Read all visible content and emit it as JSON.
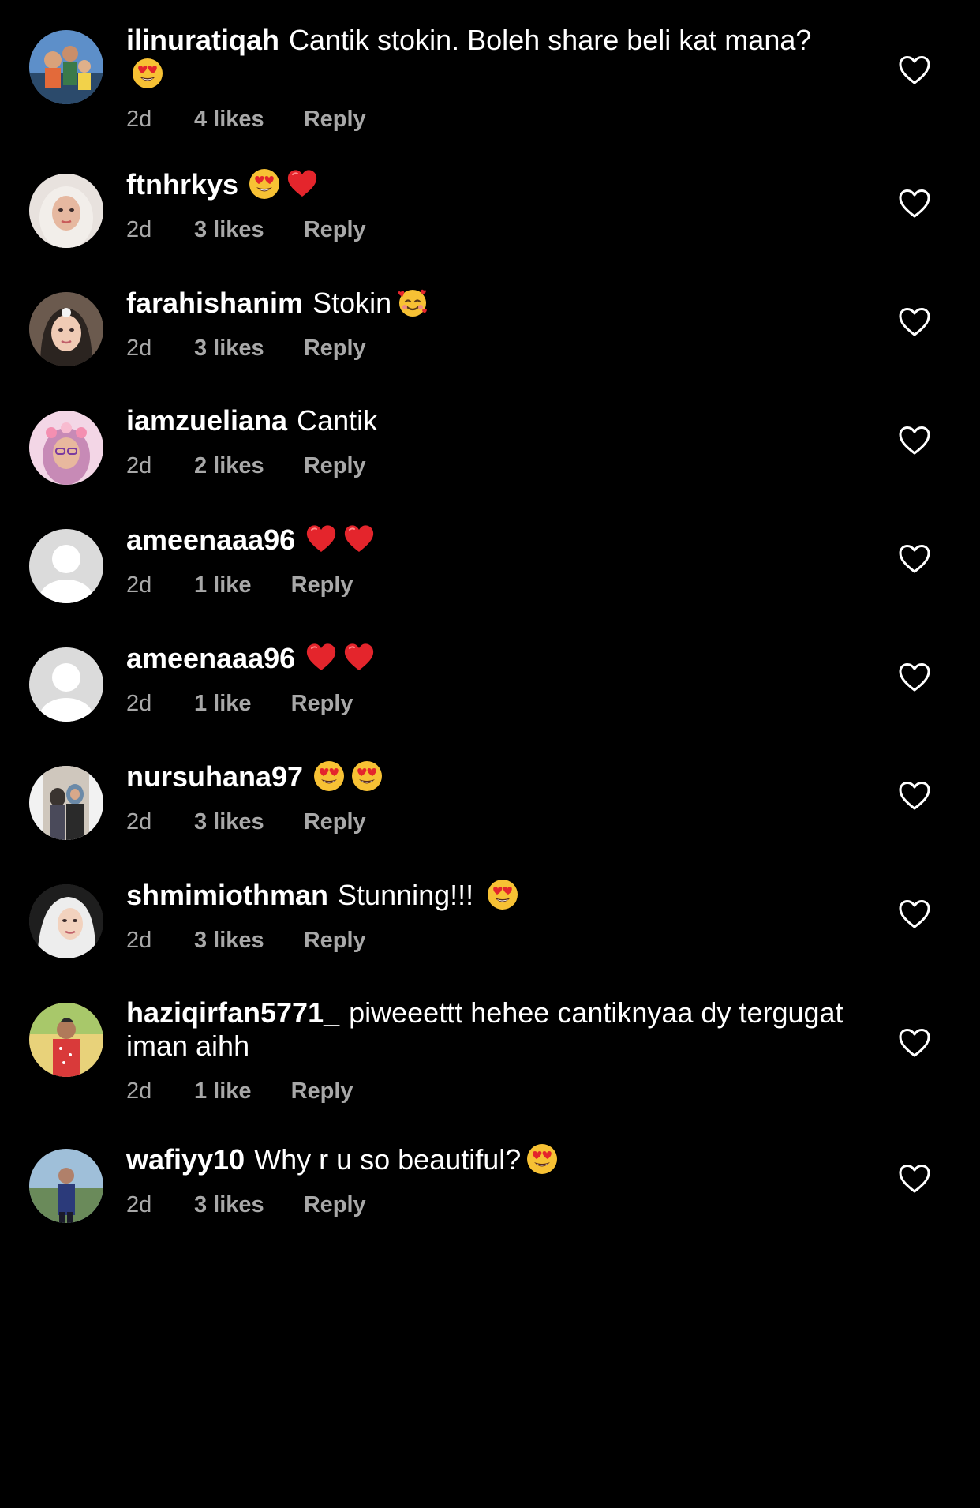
{
  "colors": {
    "background": "#000000",
    "primary_text": "#ffffff",
    "secondary_text": "#a8a8a8",
    "heart_outline": "#ffffff"
  },
  "comments": [
    {
      "username": "ilinuratiqah",
      "text": "Cantik stokin. Boleh share beli kat mana?\n",
      "emojis": [
        "heart-eyes-emoji"
      ],
      "time": "2d",
      "likes": "4 likes",
      "reply": "Reply",
      "avatar": "family-photo"
    },
    {
      "username": "ftnhrkys",
      "text": "",
      "emojis": [
        "heart-eyes-emoji",
        "red-heart-emoji"
      ],
      "time": "2d",
      "likes": "3 likes",
      "reply": "Reply",
      "avatar": "hijab-portrait"
    },
    {
      "username": "farahishanim",
      "text": "Stokin",
      "emojis": [
        "smiling-face-with-hearts-emoji"
      ],
      "time": "2d",
      "likes": "3 likes",
      "reply": "Reply",
      "avatar": "selfie-portrait"
    },
    {
      "username": "iamzueliana",
      "text": "Cantik",
      "emojis": [],
      "time": "2d",
      "likes": "2 likes",
      "reply": "Reply",
      "avatar": "flower-crown-portrait"
    },
    {
      "username": "ameenaaa96",
      "text": "",
      "emojis": [
        "red-heart-emoji",
        "red-heart-emoji"
      ],
      "time": "2d",
      "likes": "1 like",
      "reply": "Reply",
      "avatar": "default-avatar"
    },
    {
      "username": "ameenaaa96",
      "text": "",
      "emojis": [
        "red-heart-emoji",
        "red-heart-emoji"
      ],
      "time": "2d",
      "likes": "1 like",
      "reply": "Reply",
      "avatar": "default-avatar"
    },
    {
      "username": "nursuhana97",
      "text": "",
      "emojis": [
        "heart-eyes-emoji",
        "heart-eyes-emoji"
      ],
      "time": "2d",
      "likes": "3 likes",
      "reply": "Reply",
      "avatar": "two-people-photo"
    },
    {
      "username": "shmimiothman",
      "text": "Stunning!!! ",
      "emojis": [
        "heart-eyes-emoji"
      ],
      "time": "2d",
      "likes": "3 likes",
      "reply": "Reply",
      "avatar": "white-hijab-portrait"
    },
    {
      "username": "haziqirfan5771_",
      "text": "piweeettt hehee cantiknyaa dy tergugat iman aihh",
      "emojis": [],
      "time": "2d",
      "likes": "1 like",
      "reply": "Reply",
      "avatar": "red-shirt-photo"
    },
    {
      "username": "wafiyy10",
      "text": "Why r u so beautiful?",
      "emojis": [
        "heart-eyes-emoji"
      ],
      "time": "2d",
      "likes": "3 likes",
      "reply": "Reply",
      "avatar": "outdoor-photo"
    }
  ]
}
